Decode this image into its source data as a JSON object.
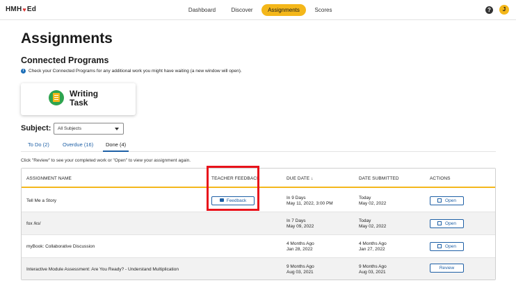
{
  "nav": {
    "logo_prefix": "HMH",
    "logo_heart": "♥",
    "logo_suffix": "Ed",
    "items": [
      {
        "label": "Dashboard",
        "active": false
      },
      {
        "label": "Discover",
        "active": false
      },
      {
        "label": "Assignments",
        "active": true
      },
      {
        "label": "Scores",
        "active": false
      }
    ],
    "help": "?",
    "avatar_initial": "J",
    "accent": "#f4b71a"
  },
  "page": {
    "title": "Assignments",
    "connected_title": "Connected Programs",
    "info_icon": "i",
    "info_text": "Check your Connected Programs for any additional work you might have waiting (a new window will open).",
    "program": {
      "line1": "Writing",
      "line2": "Task"
    },
    "subject_label": "Subject:",
    "subject_value": "All Subjects",
    "tabs": [
      {
        "label": "To Do (2)"
      },
      {
        "label": "Overdue (16)"
      },
      {
        "label": "Done (4)"
      }
    ],
    "hint": "Click \"Review\" to see your completed work or \"Open\" to view your assignment again."
  },
  "table": {
    "headers": {
      "name": "ASSIGNMENT NAME",
      "feedback": "TEACHER FEEDBACK",
      "due": "DUE DATE ↓",
      "submitted": "DATE SUBMITTED",
      "actions": "ACTIONS"
    },
    "rows": [
      {
        "name": "Tell Me a Story",
        "feedback": "Feedback",
        "due1": "In 9 Days",
        "due2": "May 11, 2022, 3:00 PM",
        "sub1": "Today",
        "sub2": "May 02, 2022",
        "action": "Open"
      },
      {
        "name": "fox /ks/",
        "feedback": "",
        "due1": "In 7 Days",
        "due2": "May 09, 2022",
        "sub1": "Today",
        "sub2": "May 02, 2022",
        "action": "Open"
      },
      {
        "name": "myBook: Collaborative Discussion",
        "feedback": "",
        "due1": "4 Months Ago",
        "due2": "Jan 28, 2022",
        "sub1": "4 Months Ago",
        "sub2": "Jan 27, 2022",
        "action": "Open"
      },
      {
        "name": "Interactive Module Assessment: Are You Ready? - Understand Multiplication",
        "feedback": "",
        "due1": "9 Months Ago",
        "due2": "Aug 03, 2021",
        "sub1": "9 Months Ago",
        "sub2": "Aug 03, 2021",
        "action": "Review"
      }
    ]
  }
}
